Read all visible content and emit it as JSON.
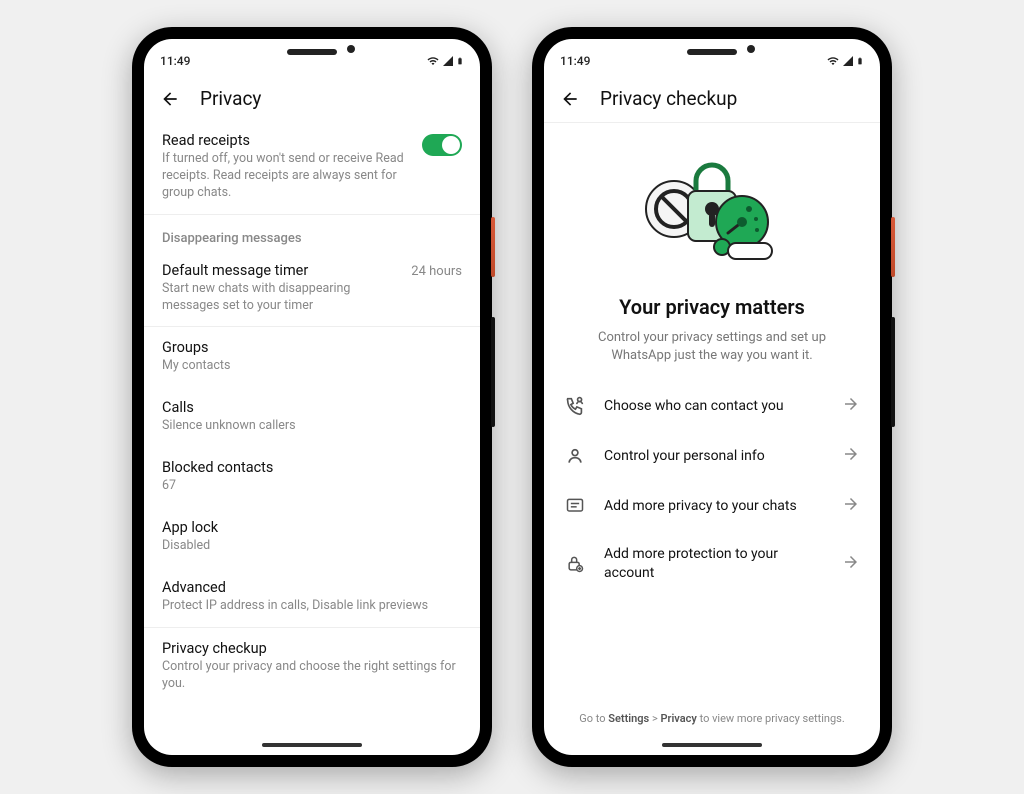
{
  "status": {
    "time": "11:49"
  },
  "phone1": {
    "title": "Privacy",
    "readReceipts": {
      "title": "Read receipts",
      "sub": "If turned off, you won't send or receive Read receipts. Read receipts are always sent for group chats.",
      "enabled": true
    },
    "disappearingHeader": "Disappearing messages",
    "timer": {
      "title": "Default message timer",
      "sub": "Start new chats with disappearing messages set to your timer",
      "value": "24 hours"
    },
    "groups": {
      "title": "Groups",
      "sub": "My contacts"
    },
    "calls": {
      "title": "Calls",
      "sub": "Silence unknown callers"
    },
    "blocked": {
      "title": "Blocked contacts",
      "sub": "67"
    },
    "applock": {
      "title": "App lock",
      "sub": "Disabled"
    },
    "advanced": {
      "title": "Advanced",
      "sub": "Protect IP address in calls, Disable link previews"
    },
    "checkup": {
      "title": "Privacy checkup",
      "sub": "Control your privacy and choose the right settings for you."
    }
  },
  "phone2": {
    "title": "Privacy checkup",
    "heroTitle": "Your privacy matters",
    "heroSub": "Control your privacy settings and set up WhatsApp just the way you want it.",
    "options": {
      "contact": "Choose who can contact you",
      "info": "Control your personal info",
      "chats": "Add more privacy to your chats",
      "account": "Add more protection to your account"
    },
    "footerPrefix": "Go to ",
    "footerBold1": "Settings",
    "footerSep": " > ",
    "footerBold2": "Privacy",
    "footerSuffix": " to view more privacy settings."
  }
}
